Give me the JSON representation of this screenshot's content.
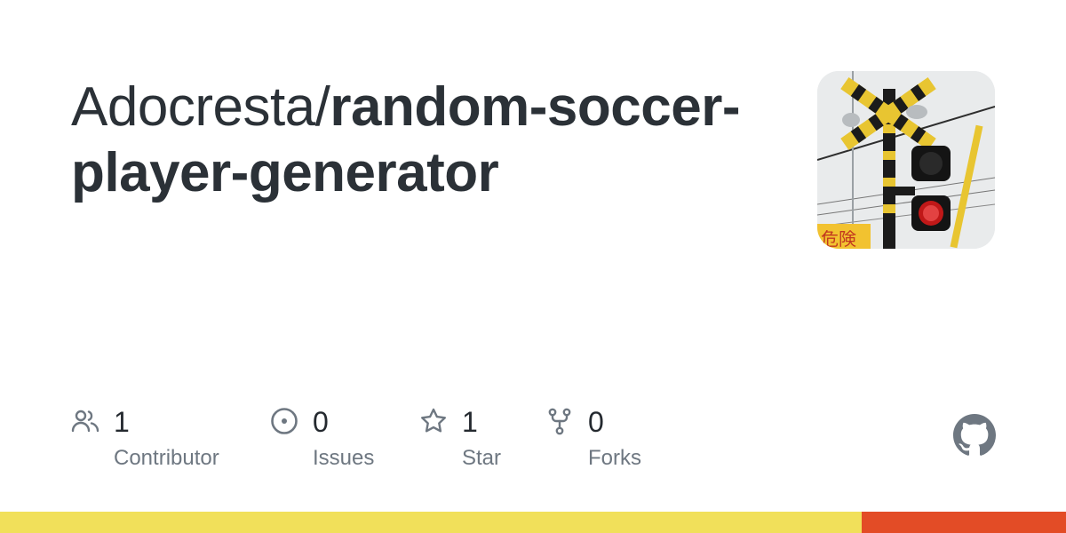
{
  "repo": {
    "owner": "Adocresta/",
    "name": "random-soccer-player-generator"
  },
  "avatar": {
    "icon": "railroad-crossing-photo",
    "alt_text": "危険"
  },
  "stats": [
    {
      "id": "contributors",
      "count": "1",
      "label": "Contributor",
      "icon": "people-icon"
    },
    {
      "id": "issues",
      "count": "0",
      "label": "Issues",
      "icon": "issue-opened-icon"
    },
    {
      "id": "stars",
      "count": "1",
      "label": "Star",
      "icon": "star-icon"
    },
    {
      "id": "forks",
      "count": "0",
      "label": "Forks",
      "icon": "repo-forked-icon"
    }
  ],
  "languages": [
    {
      "color": "#f1e05a",
      "share": 0.808
    },
    {
      "color": "#e34c26",
      "share": 0.192
    }
  ],
  "colors": {
    "icon": "#6e7781",
    "text": "#24292f",
    "muted": "#6e7781",
    "logo": "#6e7781"
  }
}
